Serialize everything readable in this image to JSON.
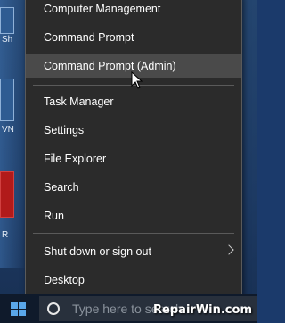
{
  "desktop": {
    "labels": [
      "Sh",
      "VN",
      "R"
    ]
  },
  "menu": {
    "items": [
      {
        "label": "Computer Management",
        "hover": false
      },
      {
        "label": "Command Prompt",
        "hover": false
      },
      {
        "label": "Command Prompt (Admin)",
        "hover": true
      },
      {
        "label": "Task Manager",
        "hover": false
      },
      {
        "label": "Settings",
        "hover": false
      },
      {
        "label": "File Explorer",
        "hover": false
      },
      {
        "label": "Search",
        "hover": false
      },
      {
        "label": "Run",
        "hover": false
      },
      {
        "label": "Shut down or sign out",
        "hover": false,
        "submenu": true
      },
      {
        "label": "Desktop",
        "hover": false
      }
    ]
  },
  "taskbar": {
    "search_placeholder": "Type here to search",
    "start_icon": "windows-logo-icon",
    "search_icon": "cortana-circle-icon"
  },
  "watermark": "RepairWin.com",
  "colors": {
    "menu_bg": "#2b2b2b",
    "hover_bg": "#4a4a4a",
    "accent": "#5aa7ea"
  }
}
